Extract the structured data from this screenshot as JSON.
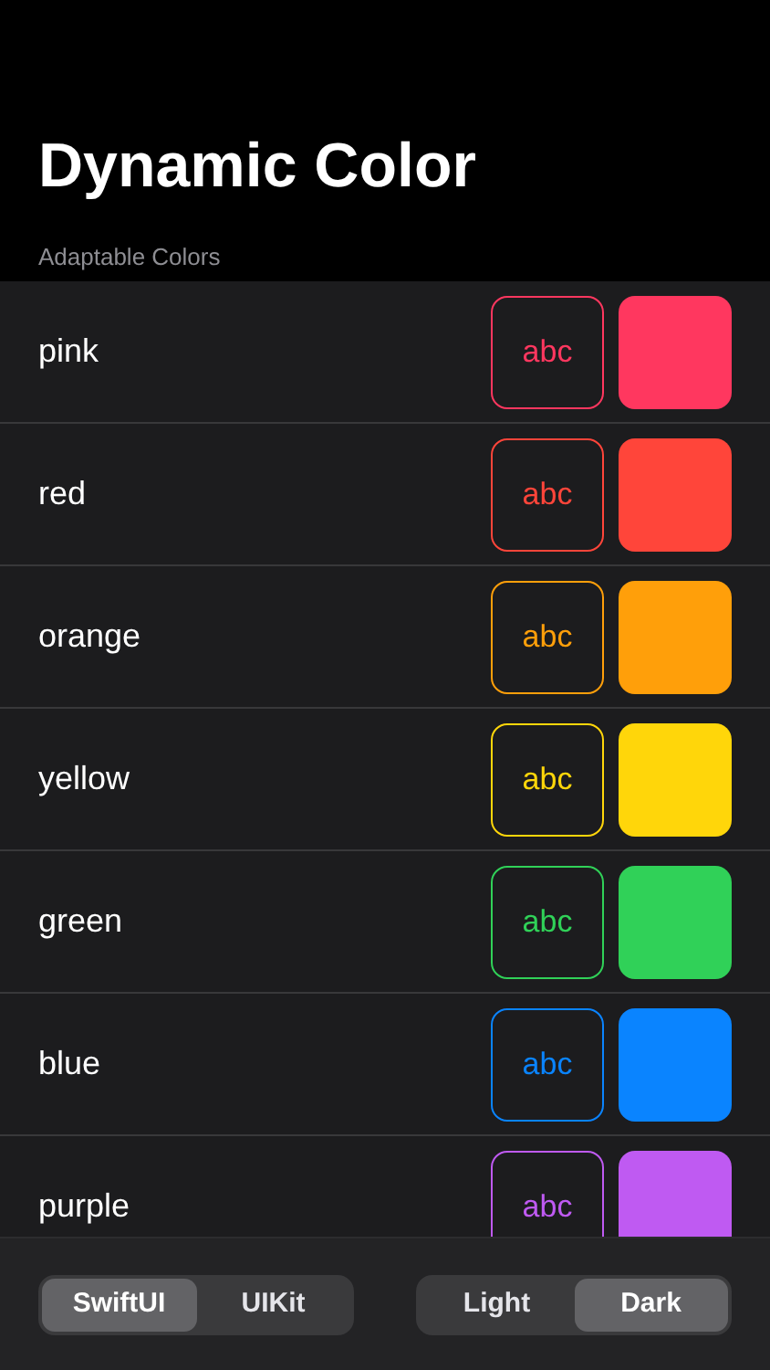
{
  "title": "Dynamic Color",
  "section_header": "Adaptable Colors",
  "colors": [
    {
      "name": "pink",
      "sample": "abc",
      "color": "#ff375f"
    },
    {
      "name": "red",
      "sample": "abc",
      "color": "#ff453a"
    },
    {
      "name": "orange",
      "sample": "abc",
      "color": "#ff9f0a"
    },
    {
      "name": "yellow",
      "sample": "abc",
      "color": "#ffd60a"
    },
    {
      "name": "green",
      "sample": "abc",
      "color": "#30d158"
    },
    {
      "name": "blue",
      "sample": "abc",
      "color": "#0a84ff"
    },
    {
      "name": "purple",
      "sample": "abc",
      "color": "#bf5af2"
    }
  ],
  "framework_picker": [
    {
      "label": "SwiftUI",
      "selected": true
    },
    {
      "label": "UIKit",
      "selected": false
    }
  ],
  "appearance_picker": [
    {
      "label": "Light",
      "selected": false
    },
    {
      "label": "Dark",
      "selected": true
    }
  ]
}
